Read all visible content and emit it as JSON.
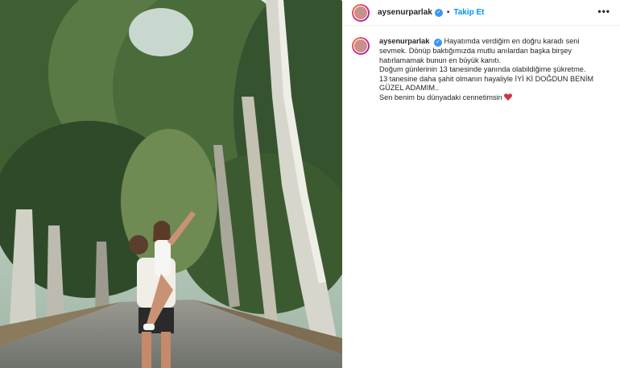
{
  "post": {
    "username": "aysenurparlak",
    "verified_glyph": "✓",
    "separator": "•",
    "follow_label": "Takip Et",
    "more_label": "•••",
    "caption_lines": [
      "Hayatımda verdiğim en doğru karadı seni",
      "sevmek. Dönüp baktığımızda mutlu anılardan başka birşey",
      "hatırlamamak bunun en büyük kanıtı.",
      "Doğum günlerinin 13 tanesinde yanında olabildiğime şükretme.",
      "13 tanesine daha şahit olmanın hayaliyle İYİ Kİ DOĞDUN BENİM",
      "GÜZEL ADAMIM..",
      "Sen benim bu dünyadaki cennetimsin"
    ]
  },
  "icons": {
    "verified": "verified-badge-icon",
    "heart": "heart-emoji-icon",
    "more": "more-options-icon"
  },
  "colors": {
    "link": "#0095f6",
    "verified": "#3897f0",
    "text": "#262626",
    "heart": "#d0344b"
  }
}
